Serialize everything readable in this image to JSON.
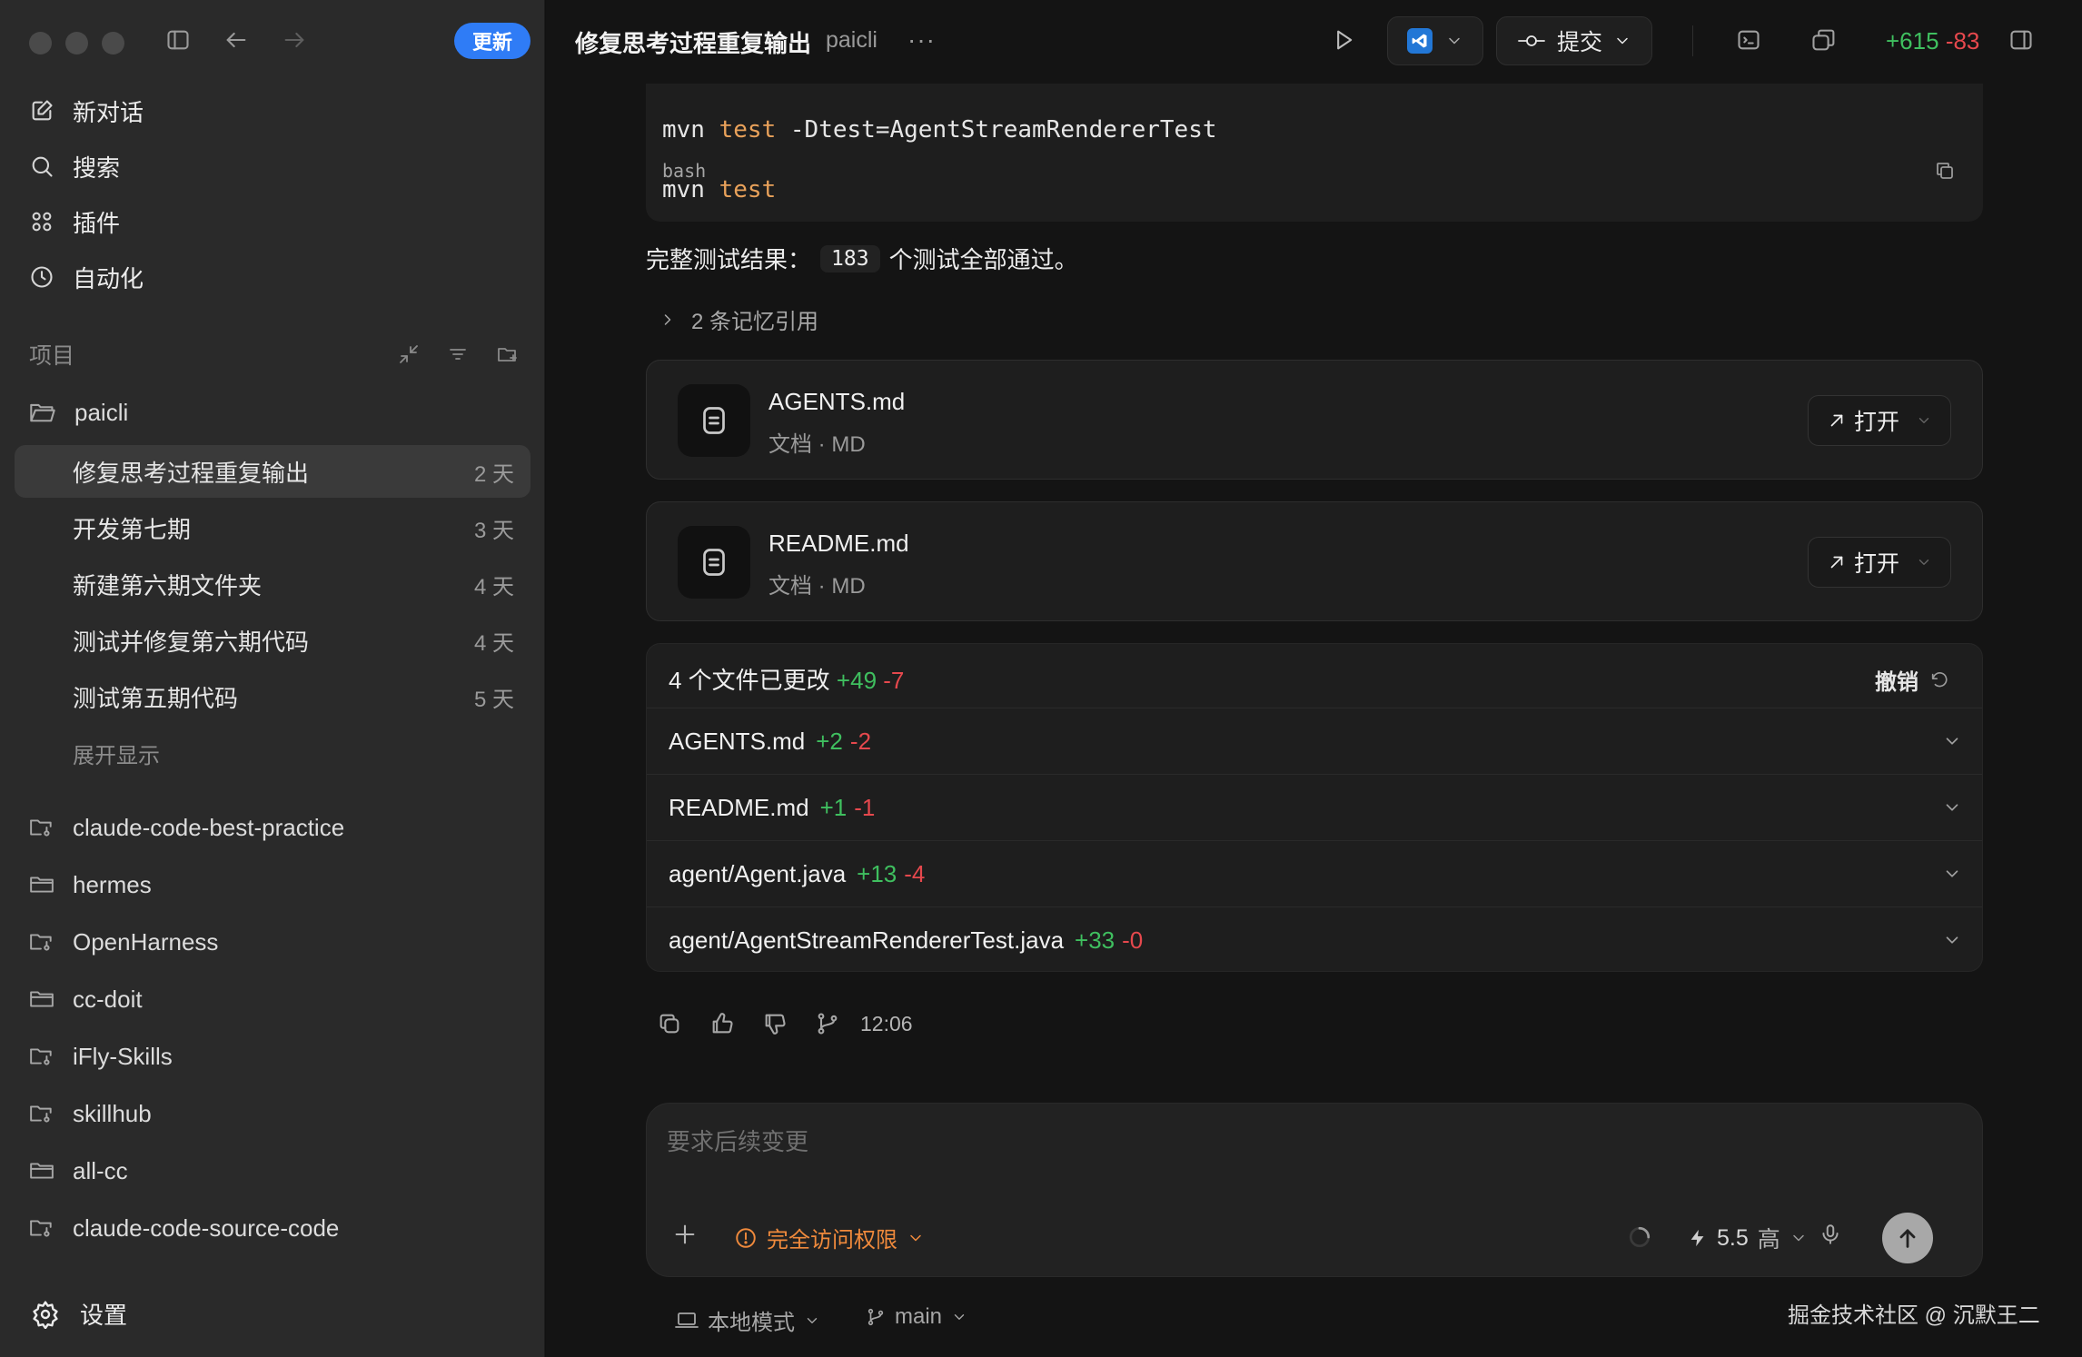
{
  "sidebar": {
    "update_label": "更新",
    "nav": [
      {
        "label": "新对话",
        "icon": "edit-icon"
      },
      {
        "label": "搜索",
        "icon": "search-icon"
      },
      {
        "label": "插件",
        "icon": "plugins-icon"
      },
      {
        "label": "自动化",
        "icon": "clock-icon"
      }
    ],
    "projects_title": "项目",
    "current_project": "paicli",
    "threads": [
      {
        "title": "修复思考过程重复输出",
        "age": "2 天",
        "active": true
      },
      {
        "title": "开发第七期",
        "age": "3 天"
      },
      {
        "title": "新建第六期文件夹",
        "age": "4 天"
      },
      {
        "title": "测试并修复第六期代码",
        "age": "4 天"
      },
      {
        "title": "测试第五期代码",
        "age": "5 天"
      }
    ],
    "expand_label": "展开显示",
    "other_projects": [
      "claude-code-best-practice",
      "hermes",
      "OpenHarness",
      "cc-doit",
      "iFly-Skills",
      "skillhub",
      "all-cc",
      "claude-code-source-code"
    ],
    "settings_label": "设置"
  },
  "topbar": {
    "title": "修复思考过程重复输出",
    "project": "paicli",
    "more": "···",
    "commit_label": "提交",
    "diff_plus": "+615",
    "diff_minus": "-83"
  },
  "code": {
    "line1_cmd": "mvn",
    "line1_kw": "test",
    "line1_rest": "-Dtest=AgentStreamRendererTest",
    "lang": "bash",
    "line2_cmd": "mvn",
    "line2_kw": "test"
  },
  "result": {
    "prefix": "完整测试结果：",
    "count": "183",
    "suffix": "个测试全部通过。"
  },
  "memory_ref": "2 条记忆引用",
  "files": [
    {
      "name": "AGENTS.md",
      "meta": "文档 · MD",
      "open_label": "打开"
    },
    {
      "name": "README.md",
      "meta": "文档 · MD",
      "open_label": "打开"
    }
  ],
  "changes": {
    "header": "4 个文件已更改",
    "plus": "+49",
    "minus": "-7",
    "undo_label": "撤销",
    "rows": [
      {
        "name": "AGENTS.md",
        "plus": "+2",
        "minus": "-2"
      },
      {
        "name": "README.md",
        "plus": "+1",
        "minus": "-1"
      },
      {
        "name": "agent/Agent.java",
        "plus": "+13",
        "minus": "-4"
      },
      {
        "name": "agent/AgentStreamRendererTest.java",
        "plus": "+33",
        "minus": "-0"
      }
    ]
  },
  "message_time": "12:06",
  "composer": {
    "placeholder": "要求后续变更",
    "access_label": "完全访问权限",
    "model_version": "5.5",
    "model_effort": "高"
  },
  "footer": {
    "local_mode": "本地模式",
    "branch": "main",
    "watermark": "掘金技术社区 @ 沉默王二"
  },
  "colors": {
    "accent_blue": "#2f7cf6",
    "diff_plus": "#3fbf5f",
    "diff_minus": "#e5484d",
    "warning_orange": "#f08a3c",
    "code_keyword": "#e8a15a"
  }
}
